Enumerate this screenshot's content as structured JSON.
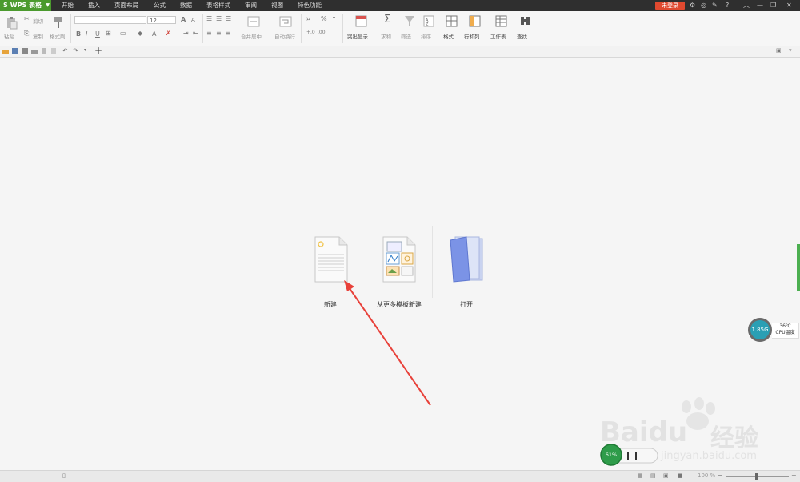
{
  "app": {
    "logo": "S",
    "name": "WPS 表格"
  },
  "menu": [
    "开始",
    "插入",
    "页面布局",
    "公式",
    "数据",
    "表格样式",
    "审阅",
    "视图",
    "特色功能"
  ],
  "top_right": {
    "login": "未登录"
  },
  "ribbon": {
    "paste": "粘贴",
    "cut": "剪切",
    "copy": "复制",
    "format_painter": "格式刷",
    "font_size": "12",
    "bold": "B",
    "italic": "I",
    "underline": "U",
    "grow_font": "A",
    "font_color": "A",
    "merge_center": "合并居中",
    "wrap_text": "自动换行",
    "percent": "%",
    "highlight": "突出显示",
    "sum": "求和",
    "filter": "筛选",
    "sort": "排序",
    "format": "格式",
    "row_col": "行和列",
    "worksheet": "工作表",
    "find": "查找"
  },
  "start_page": {
    "new": "新建",
    "new_from_template": "从更多模板新建",
    "open": "打开"
  },
  "cpu_widget": {
    "value": "1.85G",
    "temp": "36℃",
    "label": "CPU温度"
  },
  "mem_widget": {
    "percent": "61%"
  },
  "statusbar": {
    "zoom": "100 %"
  },
  "watermark": {
    "brand": "Baidu",
    "cn": "经验",
    "url": "jingyan.baidu.com"
  },
  "colors": {
    "accent_green": "#4b9a2e",
    "login_red": "#e0492f",
    "arrow_red": "#e8413a"
  }
}
